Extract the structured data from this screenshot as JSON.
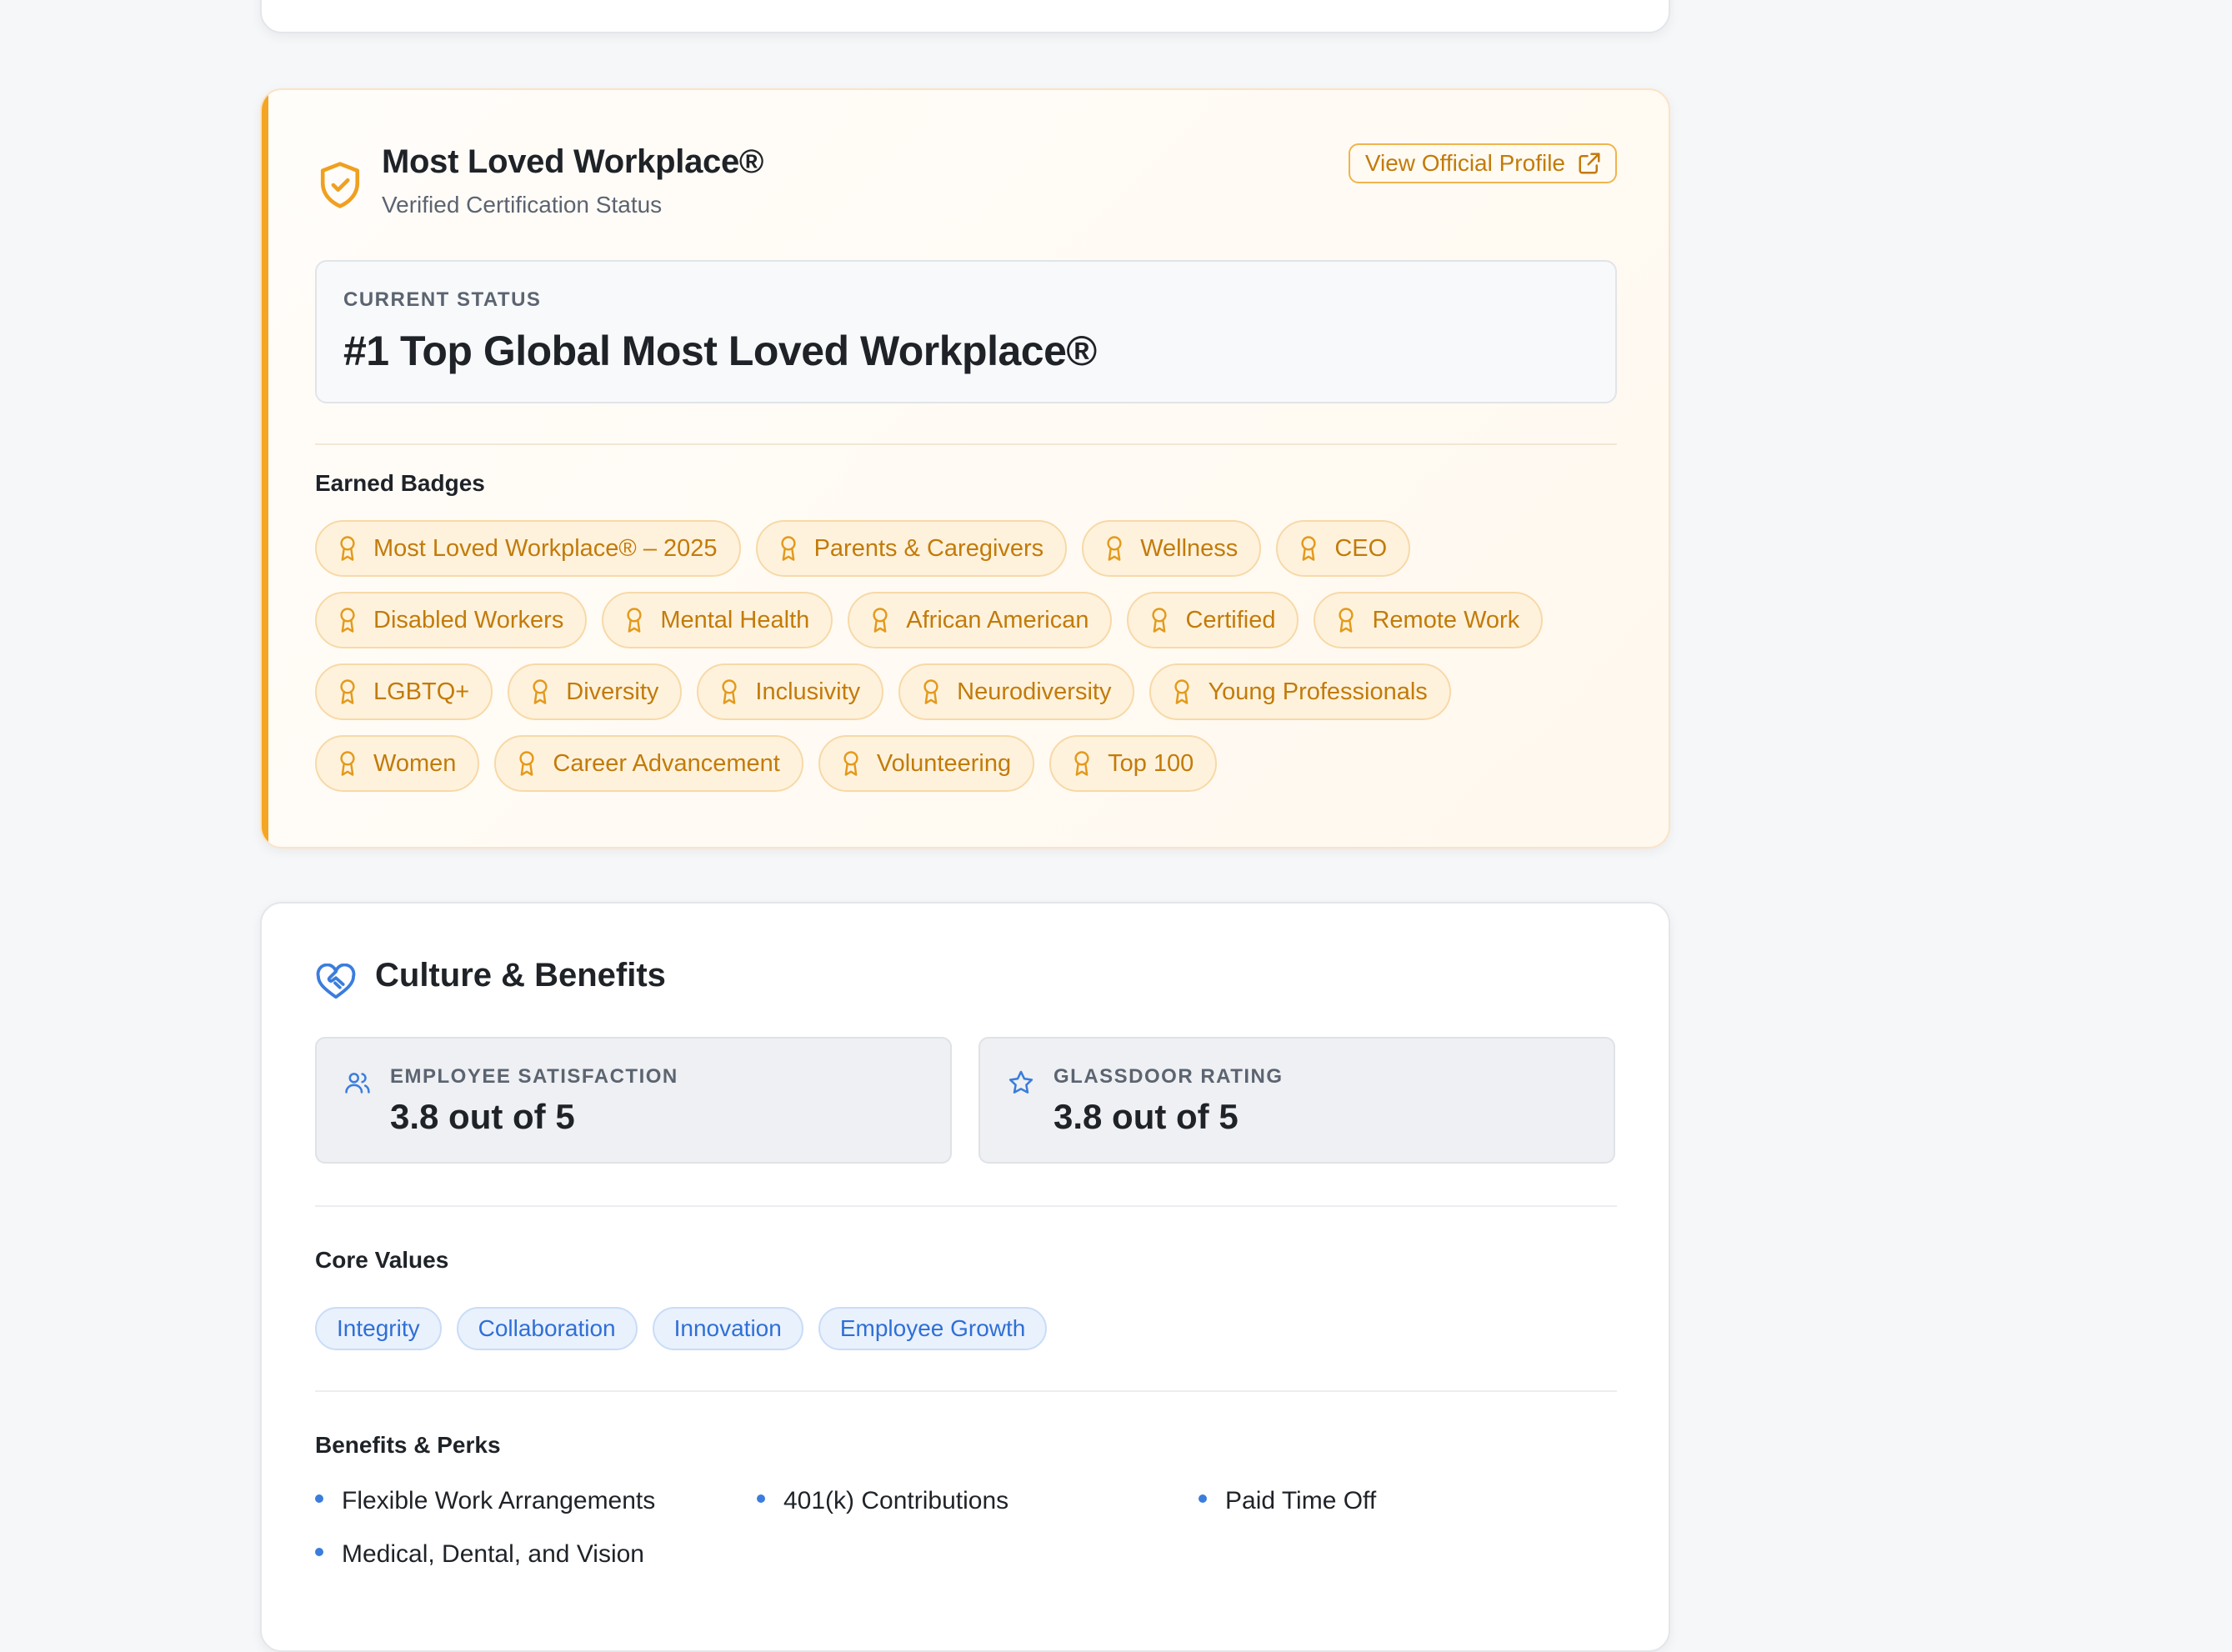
{
  "certification": {
    "title": "Most Loved Workplace®",
    "subtitle": "Verified Certification Status",
    "view_profile_label": "View Official Profile",
    "status_label": "CURRENT STATUS",
    "status_value": "#1 Top Global Most Loved Workplace®",
    "badges_heading": "Earned Badges",
    "badges": [
      "Most Loved Workplace® – 2025",
      "Parents & Caregivers",
      "Wellness",
      "CEO",
      "Disabled Workers",
      "Mental Health",
      "African American",
      "Certified",
      "Remote Work",
      "LGBTQ+",
      "Diversity",
      "Inclusivity",
      "Neurodiversity",
      "Young Professionals",
      "Women",
      "Career Advancement",
      "Volunteering",
      "Top 100"
    ],
    "accent_color": "#f5a524",
    "icons": [
      "shield-check-icon",
      "external-link-icon",
      "award-icon"
    ]
  },
  "culture": {
    "title": "Culture & Benefits",
    "stats": [
      {
        "label": "EMPLOYEE SATISFACTION",
        "value": "3.8 out of 5",
        "icon": "users-icon"
      },
      {
        "label": "GLASSDOOR RATING",
        "value": "3.8 out of 5",
        "icon": "star-icon"
      }
    ],
    "core_values_heading": "Core Values",
    "core_values": [
      "Integrity",
      "Collaboration",
      "Innovation",
      "Employee Growth"
    ],
    "benefits_heading": "Benefits & Perks",
    "benefits": [
      "Flexible Work Arrangements",
      "401(k) Contributions",
      "Paid Time Off",
      "Medical, Dental, and Vision"
    ],
    "accent_color": "#3b7ddd",
    "icons": [
      "heart-handshake-icon"
    ]
  }
}
